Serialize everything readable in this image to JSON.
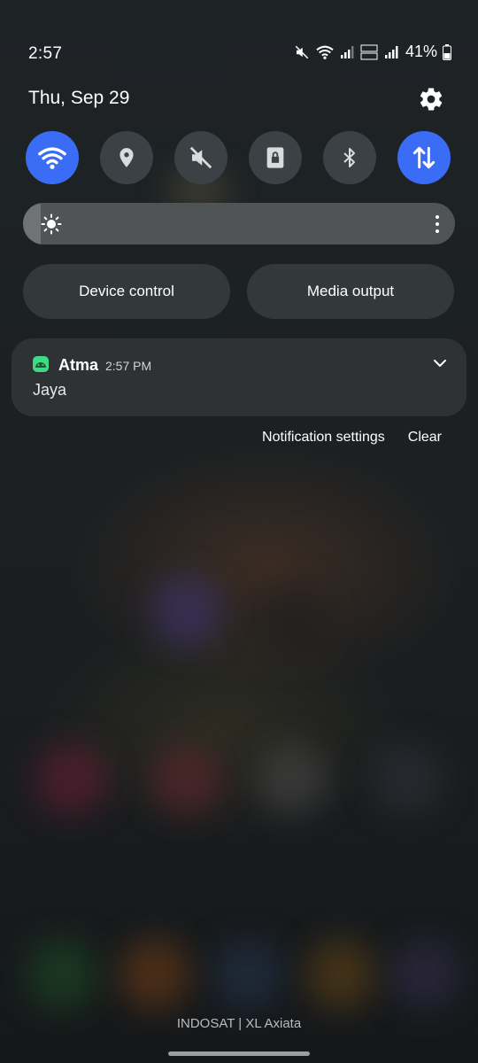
{
  "status_bar": {
    "time": "2:57",
    "battery": "41%"
  },
  "header": {
    "date": "Thu, Sep 29"
  },
  "quick_settings": [
    {
      "name": "Wi-Fi",
      "icon": "wifi-icon",
      "active": true
    },
    {
      "name": "Location",
      "icon": "location-icon",
      "active": false
    },
    {
      "name": "Sound",
      "icon": "mute-icon",
      "active": false
    },
    {
      "name": "Screen lock",
      "icon": "lock-icon",
      "active": false
    },
    {
      "name": "Bluetooth",
      "icon": "bluetooth-icon",
      "active": false
    },
    {
      "name": "Mobile data",
      "icon": "data-arrows-icon",
      "active": true
    }
  ],
  "brightness": {
    "level": 0.04
  },
  "buttons": {
    "device_control": "Device control",
    "media_output": "Media output"
  },
  "notification": {
    "app": "Atma",
    "time": "2:57 PM",
    "text": "Jaya"
  },
  "notification_actions": {
    "settings": "Notification settings",
    "clear": "Clear"
  },
  "footer": {
    "carrier": "INDOSAT | XL Axiata"
  },
  "colors": {
    "accent": "#3b6cf6",
    "tile": "#3c4145",
    "panel": "#2e3234",
    "android_green": "#3ddc84"
  }
}
